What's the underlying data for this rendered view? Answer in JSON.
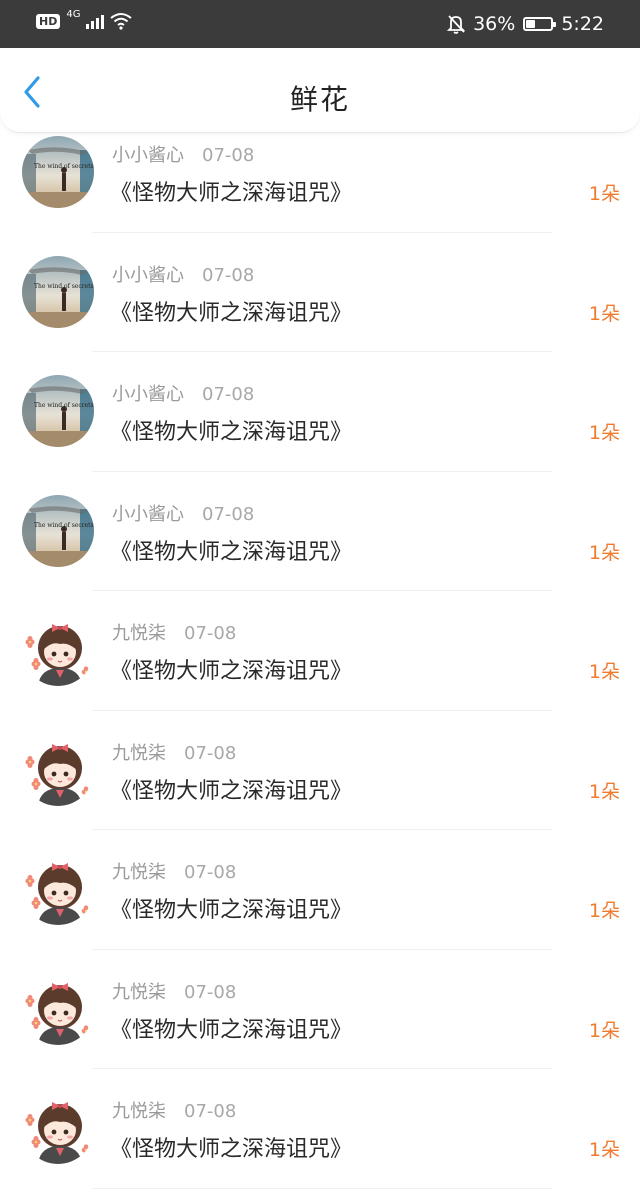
{
  "status_bar": {
    "hd": "HD",
    "network": "4G",
    "battery_text": "36%",
    "battery_level": 0.36,
    "time": "5:22"
  },
  "header": {
    "back_icon": "chevron-left-icon",
    "title": "鲜花",
    "accent": "#2f9be8"
  },
  "colors": {
    "count": "#f07a2e",
    "username": "#9a9a9a",
    "book": "#2a2a2a"
  },
  "items": [
    {
      "user": "小小酱心",
      "date": "07-08",
      "book": "《怪物大师之深海诅咒》",
      "count": "1朵",
      "avatar": "scenic-avatar",
      "avatar_text": "The wind of secrets"
    },
    {
      "user": "小小酱心",
      "date": "07-08",
      "book": "《怪物大师之深海诅咒》",
      "count": "1朵",
      "avatar": "scenic-avatar",
      "avatar_text": "The wind of secrets"
    },
    {
      "user": "小小酱心",
      "date": "07-08",
      "book": "《怪物大师之深海诅咒》",
      "count": "1朵",
      "avatar": "scenic-avatar",
      "avatar_text": "The wind of secrets"
    },
    {
      "user": "小小酱心",
      "date": "07-08",
      "book": "《怪物大师之深海诅咒》",
      "count": "1朵",
      "avatar": "scenic-avatar",
      "avatar_text": "The wind of secrets"
    },
    {
      "user": "九悦柒",
      "date": "07-08",
      "book": "《怪物大师之深海诅咒》",
      "count": "1朵",
      "avatar": "cartoon-girl-avatar"
    },
    {
      "user": "九悦柒",
      "date": "07-08",
      "book": "《怪物大师之深海诅咒》",
      "count": "1朵",
      "avatar": "cartoon-girl-avatar"
    },
    {
      "user": "九悦柒",
      "date": "07-08",
      "book": "《怪物大师之深海诅咒》",
      "count": "1朵",
      "avatar": "cartoon-girl-avatar"
    },
    {
      "user": "九悦柒",
      "date": "07-08",
      "book": "《怪物大师之深海诅咒》",
      "count": "1朵",
      "avatar": "cartoon-girl-avatar"
    },
    {
      "user": "九悦柒",
      "date": "07-08",
      "book": "《怪物大师之深海诅咒》",
      "count": "1朵",
      "avatar": "cartoon-girl-avatar"
    }
  ]
}
